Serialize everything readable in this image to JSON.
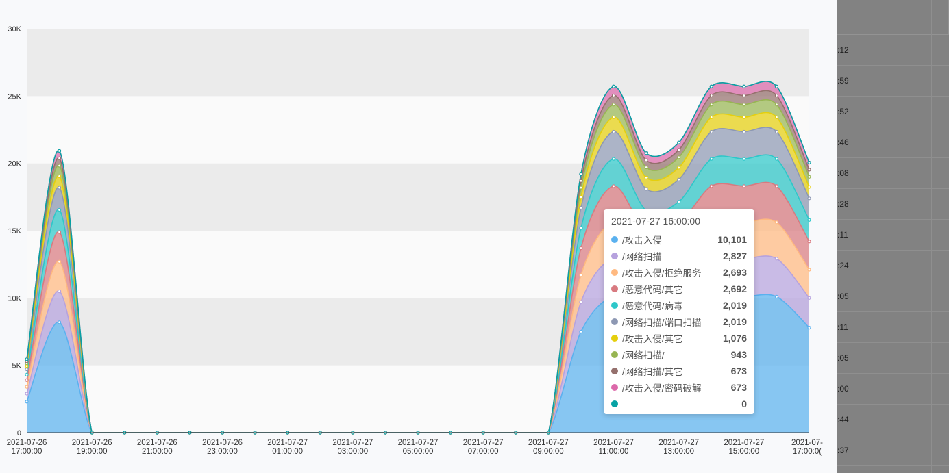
{
  "chart_data": {
    "type": "area",
    "stacked": true,
    "y_ticks": [
      "0",
      "5K",
      "10K",
      "15K",
      "20K",
      "25K",
      "30K"
    ],
    "ylim": [
      0,
      30000
    ],
    "x": [
      "2021-07-26 17:00:00",
      "2021-07-26 18:00:00",
      "2021-07-26 19:00:00",
      "2021-07-26 20:00:00",
      "2021-07-26 21:00:00",
      "2021-07-26 22:00:00",
      "2021-07-26 23:00:00",
      "2021-07-27 00:00:00",
      "2021-07-27 01:00:00",
      "2021-07-27 02:00:00",
      "2021-07-27 03:00:00",
      "2021-07-27 04:00:00",
      "2021-07-27 05:00:00",
      "2021-07-27 06:00:00",
      "2021-07-27 07:00:00",
      "2021-07-27 08:00:00",
      "2021-07-27 09:00:00",
      "2021-07-27 10:00:00",
      "2021-07-27 11:00:00",
      "2021-07-27 12:00:00",
      "2021-07-27 13:00:00",
      "2021-07-27 14:00:00",
      "2021-07-27 15:00:00",
      "2021-07-27 16:00:00",
      "2021-07-27 17:00:00"
    ],
    "x_tick_labels": [
      {
        "date": "2021-07-26",
        "time": "17:00:00"
      },
      {
        "date": "2021-07-26",
        "time": "19:00:00"
      },
      {
        "date": "2021-07-26",
        "time": "21:00:00"
      },
      {
        "date": "2021-07-26",
        "time": "23:00:00"
      },
      {
        "date": "2021-07-27",
        "time": "01:00:00"
      },
      {
        "date": "2021-07-27",
        "time": "03:00:00"
      },
      {
        "date": "2021-07-27",
        "time": "05:00:00"
      },
      {
        "date": "2021-07-27",
        "time": "07:00:00"
      },
      {
        "date": "2021-07-27",
        "time": "09:00:00"
      },
      {
        "date": "2021-07-27",
        "time": "11:00:00"
      },
      {
        "date": "2021-07-27",
        "time": "13:00:00"
      },
      {
        "date": "2021-07-27",
        "time": "15:00:00"
      },
      {
        "date": "2021-07-",
        "time": "17:00:0("
      }
    ],
    "series": [
      {
        "name": "/攻击入侵",
        "color": "#5ab1ef",
        "values": [
          2300,
          8200,
          0,
          0,
          0,
          0,
          0,
          0,
          0,
          0,
          0,
          0,
          0,
          0,
          0,
          0,
          0,
          7500,
          10100,
          8500,
          8800,
          10100,
          10100,
          10101,
          7800
        ]
      },
      {
        "name": "/网络扫描",
        "color": "#b6a2de",
        "values": [
          600,
          2300,
          0,
          0,
          0,
          0,
          0,
          0,
          0,
          0,
          0,
          0,
          0,
          0,
          0,
          0,
          0,
          2200,
          2827,
          2200,
          2300,
          2827,
          2827,
          2827,
          2200
        ]
      },
      {
        "name": "/攻击入侵/拒绝服务",
        "color": "#ffb980",
        "values": [
          500,
          2200,
          0,
          0,
          0,
          0,
          0,
          0,
          0,
          0,
          0,
          0,
          0,
          0,
          0,
          0,
          0,
          2000,
          2693,
          2100,
          2200,
          2693,
          2693,
          2693,
          2100
        ]
      },
      {
        "name": "/恶意代码/其它",
        "color": "#d87a80",
        "values": [
          500,
          2200,
          0,
          0,
          0,
          0,
          0,
          0,
          0,
          0,
          0,
          0,
          0,
          0,
          0,
          0,
          0,
          2000,
          2692,
          2100,
          2200,
          2692,
          2692,
          2692,
          2100
        ]
      },
      {
        "name": "/恶意代码/病毒",
        "color": "#2ec7c9",
        "values": [
          400,
          1650,
          0,
          0,
          0,
          0,
          0,
          0,
          0,
          0,
          0,
          0,
          0,
          0,
          0,
          0,
          0,
          1500,
          2019,
          1600,
          1650,
          2019,
          2019,
          2019,
          1600
        ]
      },
      {
        "name": "/网络扫描/端口扫描",
        "color": "#8d98b3",
        "values": [
          400,
          1650,
          0,
          0,
          0,
          0,
          0,
          0,
          0,
          0,
          0,
          0,
          0,
          0,
          0,
          0,
          0,
          1500,
          2019,
          1600,
          1650,
          2019,
          2019,
          2019,
          1600
        ]
      },
      {
        "name": "/攻击入侵/其它",
        "color": "#e5cf0d",
        "values": [
          250,
          850,
          0,
          0,
          0,
          0,
          0,
          0,
          0,
          0,
          0,
          0,
          0,
          0,
          0,
          0,
          0,
          800,
          1076,
          850,
          880,
          1076,
          1076,
          1076,
          850
        ]
      },
      {
        "name": "/网络扫描/",
        "color": "#97b552",
        "values": [
          200,
          780,
          0,
          0,
          0,
          0,
          0,
          0,
          0,
          0,
          0,
          0,
          0,
          0,
          0,
          0,
          0,
          700,
          943,
          750,
          770,
          943,
          943,
          943,
          750
        ]
      },
      {
        "name": "/网络扫描/其它",
        "color": "#95706d",
        "values": [
          150,
          550,
          0,
          0,
          0,
          0,
          0,
          0,
          0,
          0,
          0,
          0,
          0,
          0,
          0,
          0,
          0,
          500,
          673,
          530,
          550,
          673,
          673,
          673,
          530
        ]
      },
      {
        "name": "/攻击入侵/密码破解",
        "color": "#dc69aa",
        "values": [
          150,
          550,
          0,
          0,
          0,
          0,
          0,
          0,
          0,
          0,
          0,
          0,
          0,
          0,
          0,
          0,
          0,
          500,
          673,
          530,
          550,
          673,
          673,
          673,
          530
        ]
      },
      {
        "name": "",
        "color": "#07a2a4",
        "values": [
          0,
          0,
          0,
          0,
          0,
          0,
          0,
          0,
          0,
          0,
          0,
          0,
          0,
          0,
          0,
          0,
          0,
          0,
          0,
          0,
          0,
          0,
          0,
          0,
          0
        ]
      }
    ],
    "grid": true
  },
  "tooltip": {
    "title": "2021-07-27 16:00:00",
    "rows": [
      {
        "name": "/攻击入侵",
        "value": "10,101",
        "color": "#5ab1ef"
      },
      {
        "name": "/网络扫描",
        "value": "2,827",
        "color": "#b6a2de"
      },
      {
        "name": "/攻击入侵/拒绝服务",
        "value": "2,693",
        "color": "#ffb980"
      },
      {
        "name": "/恶意代码/其它",
        "value": "2,692",
        "color": "#d87a80"
      },
      {
        "name": "/恶意代码/病毒",
        "value": "2,019",
        "color": "#2ec7c9"
      },
      {
        "name": "/网络扫描/端口扫描",
        "value": "2,019",
        "color": "#8d98b3"
      },
      {
        "name": "/攻击入侵/其它",
        "value": "1,076",
        "color": "#e5cf0d"
      },
      {
        "name": "/网络扫描/",
        "value": "943",
        "color": "#97b552"
      },
      {
        "name": "/网络扫描/其它",
        "value": "673",
        "color": "#95706d"
      },
      {
        "name": "/攻击入侵/密码破解",
        "value": "673",
        "color": "#dc69aa"
      },
      {
        "name": "",
        "value": "0",
        "color": "#07a2a4"
      }
    ]
  },
  "side_panel": {
    "rows": [
      ":12",
      ":59",
      ":52",
      ":46",
      ":08",
      ":28",
      ":11",
      ":24",
      ":05",
      ":11",
      ":05",
      ":00",
      ":44",
      ":37"
    ]
  }
}
